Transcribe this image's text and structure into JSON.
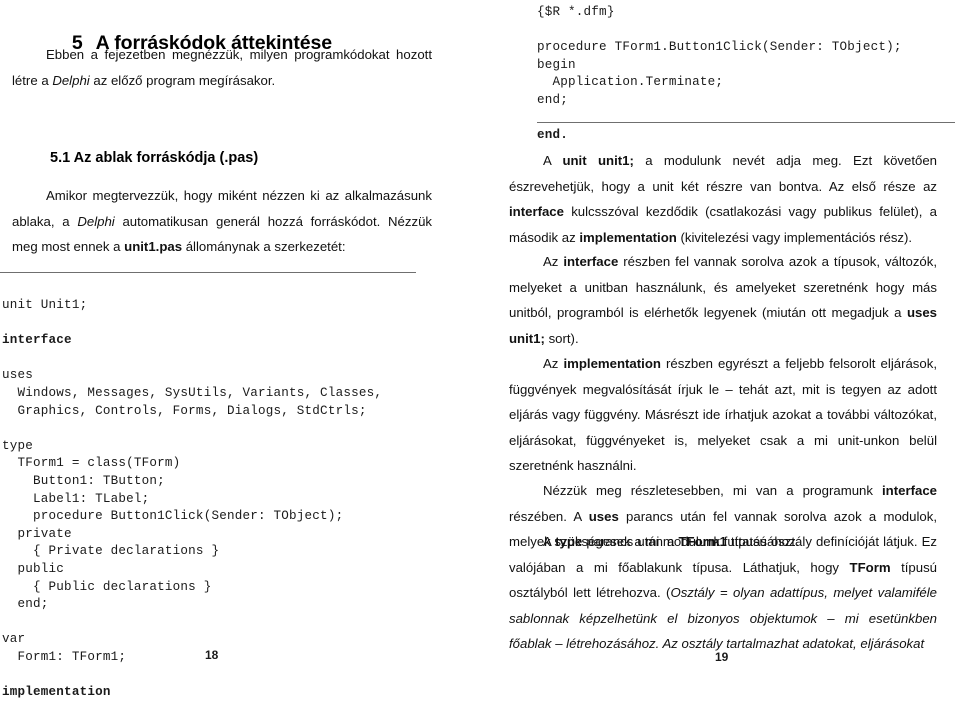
{
  "document": {
    "language": "hu",
    "left_page": {
      "folio": "18",
      "heading": {
        "number": "5",
        "text": "A forráskódok áttekintése"
      },
      "intro_paragraph": "Ebben a fejezetben megnézzük, milyen programkódokat hozott létre a Delphi az előző program megírásakor.",
      "intro_paragraph_parts": [
        {
          "text": "Ebben a fejezetben megnézzük, milyen programkódokat hozott létre a ",
          "style": "normal"
        },
        {
          "text": "Delphi",
          "style": "italic"
        },
        {
          "text": " az előző program megírásakor.",
          "style": "normal"
        }
      ],
      "subheading": "5.1 Az ablak forráskódja (.pas)",
      "paragraph_2_parts": [
        {
          "text": "Amikor megtervezzük, hogy miként nézzen ki az alkalmazásunk ablaka, a ",
          "style": "normal"
        },
        {
          "text": "Delphi",
          "style": "italic"
        },
        {
          "text": " automatikusan generál hozzá forráskódot. Nézzük meg most ennek a ",
          "style": "normal"
        },
        {
          "text": "unit1.pas",
          "style": "bold"
        },
        {
          "text": " állománynak a szerkezetét:",
          "style": "normal"
        }
      ],
      "code_lines": [
        {
          "text": "unit Unit1;",
          "bold": false
        },
        {
          "text": "",
          "bold": false
        },
        {
          "text": "interface",
          "bold": true
        },
        {
          "text": "",
          "bold": false
        },
        {
          "text": "uses",
          "bold": false
        },
        {
          "text": "  Windows, Messages, SysUtils, Variants, Classes,",
          "bold": false
        },
        {
          "text": "  Graphics, Controls, Forms, Dialogs, StdCtrls;",
          "bold": false
        },
        {
          "text": "",
          "bold": false
        },
        {
          "text": "type",
          "bold": false
        },
        {
          "text": "  TForm1 = class(TForm)",
          "bold": false
        },
        {
          "text": "    Button1: TButton;",
          "bold": false
        },
        {
          "text": "    Label1: TLabel;",
          "bold": false
        },
        {
          "text": "    procedure Button1Click(Sender: TObject);",
          "bold": false
        },
        {
          "text": "  private",
          "bold": false
        },
        {
          "text": "    { Private declarations }",
          "bold": false
        },
        {
          "text": "  public",
          "bold": false
        },
        {
          "text": "    { Public declarations }",
          "bold": false
        },
        {
          "text": "  end;",
          "bold": false
        },
        {
          "text": "",
          "bold": false
        },
        {
          "text": "var",
          "bold": false
        },
        {
          "text": "  Form1: TForm1;",
          "bold": false
        },
        {
          "text": "",
          "bold": false
        },
        {
          "text": "implementation",
          "bold": true
        }
      ]
    },
    "right_page": {
      "folio": "19",
      "code_lines": [
        {
          "text": "{$R *.dfm}",
          "bold": false
        },
        {
          "text": "",
          "bold": false
        },
        {
          "text": "procedure TForm1.Button1Click(Sender: TObject);",
          "bold": false
        },
        {
          "text": "begin",
          "bold": false
        },
        {
          "text": "  Application.Terminate;",
          "bold": false
        },
        {
          "text": "end;",
          "bold": false
        },
        {
          "text": "",
          "bold": false
        },
        {
          "text": "end.",
          "bold": true
        }
      ],
      "paragraphs": [
        {
          "id": "p1",
          "parts": [
            {
              "text": "A ",
              "style": "normal"
            },
            {
              "text": "unit unit1;",
              "style": "bold"
            },
            {
              "text": " a modulunk nevét adja meg. Ezt követően észrevehetjük, hogy a unit két részre van bontva. Az első része az ",
              "style": "normal"
            },
            {
              "text": "interface",
              "style": "bold"
            },
            {
              "text": " kulcsszóval kezdődik (csatlakozási vagy publikus felület), a második az ",
              "style": "normal"
            },
            {
              "text": "implementation",
              "style": "bold"
            },
            {
              "text": " (kivitelezési vagy implementációs rész).",
              "style": "normal"
            }
          ]
        },
        {
          "id": "p2",
          "parts": [
            {
              "text": "Az ",
              "style": "normal"
            },
            {
              "text": "interface",
              "style": "bold"
            },
            {
              "text": " részben fel vannak sorolva azok a típusok, változók, melyeket a unitban használunk, és amelyeket szeretnénk hogy más unitból, programból is elérhetők legyenek (miután ott megadjuk a ",
              "style": "normal"
            },
            {
              "text": "uses unit1;",
              "style": "bold"
            },
            {
              "text": " sort).",
              "style": "normal"
            }
          ]
        },
        {
          "id": "p3",
          "parts": [
            {
              "text": "Az ",
              "style": "normal"
            },
            {
              "text": "implementation",
              "style": "bold"
            },
            {
              "text": " részben egyrészt a feljebb felsorolt eljárások, függvények megvalósítását írjuk le – tehát azt, mit is tegyen az adott eljárás vagy függvény. Másrészt ide írhatjuk azokat a további változókat, eljárásokat, függvényeket is, melyeket csak a mi unit-unkon belül szeretnénk használni.",
              "style": "normal"
            }
          ]
        },
        {
          "id": "p4",
          "parts": [
            {
              "text": "Nézzük meg részletesebben, mi van a programunk ",
              "style": "normal"
            },
            {
              "text": "interface",
              "style": "bold"
            },
            {
              "text": " részében. A ",
              "style": "normal"
            },
            {
              "text": "uses",
              "style": "bold"
            },
            {
              "text": " parancs után fel vannak sorolva azok a modulok, melyek szükségesek a mi modulunk futtatásához.",
              "style": "normal"
            }
          ]
        },
        {
          "id": "p5",
          "parts": [
            {
              "text": "A ",
              "style": "normal"
            },
            {
              "text": "type",
              "style": "bold"
            },
            {
              "text": " parancs után a ",
              "style": "normal"
            },
            {
              "text": "TForm1",
              "style": "bold"
            },
            {
              "text": " típusú osztály definícióját látjuk. Ez valójában a mi főablakunk típusa. Láthatjuk, hogy ",
              "style": "normal"
            },
            {
              "text": "TForm",
              "style": "bold"
            },
            {
              "text": " típusú osztályból lett létrehozva. (",
              "style": "normal"
            },
            {
              "text": "Osztály = olyan adattípus, melyet valamiféle sablonnak képzelhetünk el bizonyos objektumok – mi esetünkben főablak – létrehozásához. Az osztály tartalmazhat adatokat, eljárásokat",
              "style": "italic"
            }
          ]
        }
      ]
    }
  }
}
